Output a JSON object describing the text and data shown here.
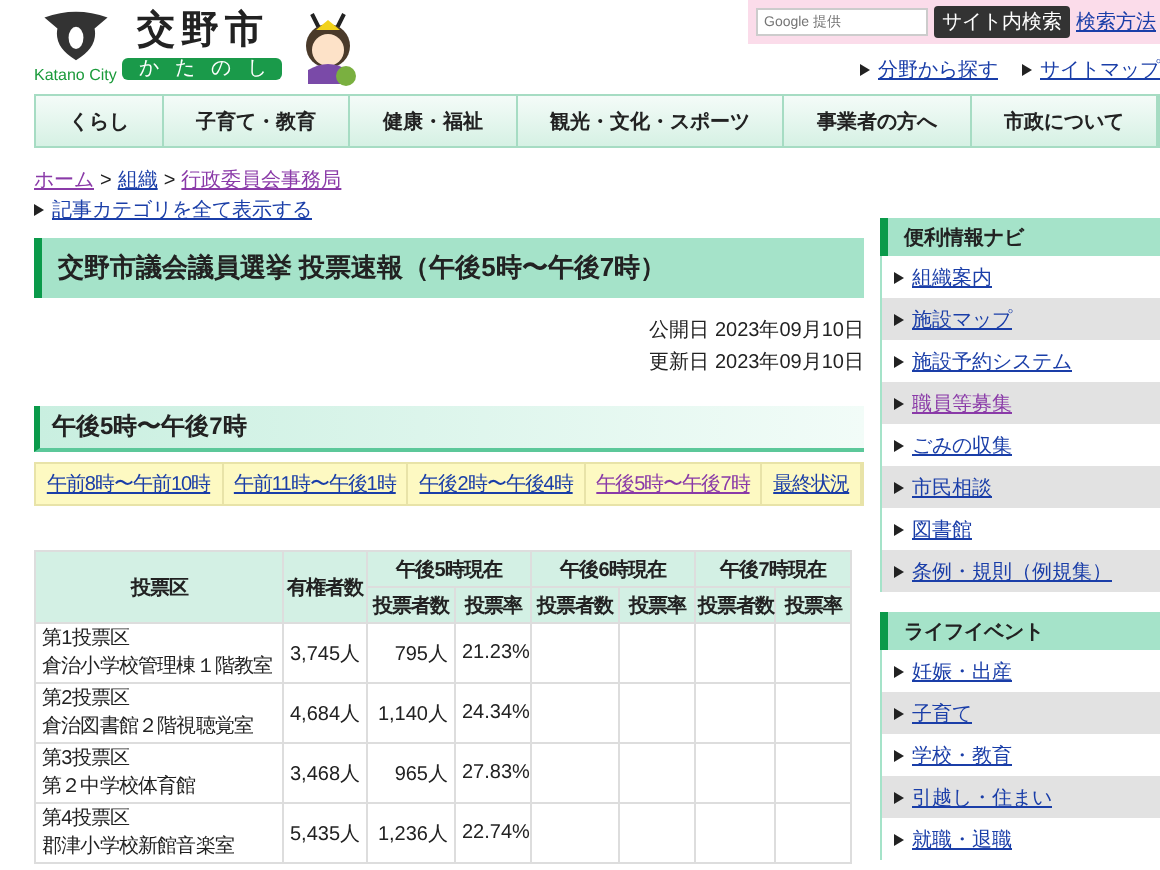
{
  "header": {
    "logo": {
      "title": "交野市",
      "subtitle": "Katano City",
      "reading": "かたのし"
    },
    "search": {
      "placeholder": "Google 提供",
      "button": "サイト内検索",
      "help_link": "検索方法"
    },
    "links": [
      "分野から探す",
      "サイトマップ"
    ]
  },
  "nav": [
    "くらし",
    "子育て・教育",
    "健康・福祉",
    "観光・文化・スポーツ",
    "事業者の方へ",
    "市政について"
  ],
  "breadcrumb_separators": [
    ">",
    ">"
  ],
  "breadcrumb": [
    {
      "label": "ホーム",
      "visited": true
    },
    {
      "label": "組織",
      "visited": false
    },
    {
      "label": "行政委員会事務局",
      "visited": true
    }
  ],
  "category_link": "記事カテゴリを全て表示する",
  "page_title": "交野市議会議員選挙 投票速報（午後5時〜午後7時）",
  "published": "公開日 2023年09月10日",
  "updated": "更新日 2023年09月10日",
  "section_heading": "午後5時〜午後7時",
  "time_tabs": [
    {
      "label": "午前8時〜午前10時",
      "selected": false
    },
    {
      "label": "午前11時〜午後1時",
      "selected": false
    },
    {
      "label": "午後2時〜午後4時",
      "selected": false
    },
    {
      "label": "午後5時〜午後7時",
      "selected": true
    },
    {
      "label": "最終状況",
      "selected": false
    }
  ],
  "table": {
    "columns": {
      "district": "投票区",
      "eligible": "有権者数",
      "groups": [
        {
          "label": "午後5時現在",
          "sub": [
            "投票者数",
            "投票率"
          ]
        },
        {
          "label": "午後6時現在",
          "sub": [
            "投票者数",
            "投票率"
          ]
        },
        {
          "label": "午後7時現在",
          "sub": [
            "投票者数",
            "投票率"
          ]
        }
      ]
    },
    "rows": [
      {
        "district": "第1投票区",
        "place": "倉治小学校管理棟１階教室",
        "eligible": "3,745人",
        "voted": "795人",
        "rate": "21.23%"
      },
      {
        "district": "第2投票区",
        "place": "倉治図書館２階視聴覚室",
        "eligible": "4,684人",
        "voted": "1,140人",
        "rate": "24.34%"
      },
      {
        "district": "第3投票区",
        "place": "第２中学校体育館",
        "eligible": "3,468人",
        "voted": "965人",
        "rate": "27.83%"
      },
      {
        "district": "第4投票区",
        "place": "郡津小学校新館音楽室",
        "eligible": "5,435人",
        "voted": "1,236人",
        "rate": "22.74%"
      }
    ]
  },
  "sidebar": [
    {
      "title": "便利情報ナビ",
      "items": [
        {
          "label": "組織案内",
          "visited": false
        },
        {
          "label": "施設マップ",
          "visited": false
        },
        {
          "label": "施設予約システム",
          "visited": false
        },
        {
          "label": "職員等募集",
          "visited": true
        },
        {
          "label": "ごみの収集",
          "visited": false
        },
        {
          "label": "市民相談",
          "visited": false
        },
        {
          "label": "図書館",
          "visited": false
        },
        {
          "label": "条例・規則（例規集）",
          "visited": false
        }
      ]
    },
    {
      "title": "ライフイベント",
      "items": [
        {
          "label": "妊娠・出産",
          "visited": false
        },
        {
          "label": "子育て",
          "visited": false
        },
        {
          "label": "学校・教育",
          "visited": false
        },
        {
          "label": "引越し・住まい",
          "visited": false
        },
        {
          "label": "就職・退職",
          "visited": false
        }
      ]
    }
  ]
}
